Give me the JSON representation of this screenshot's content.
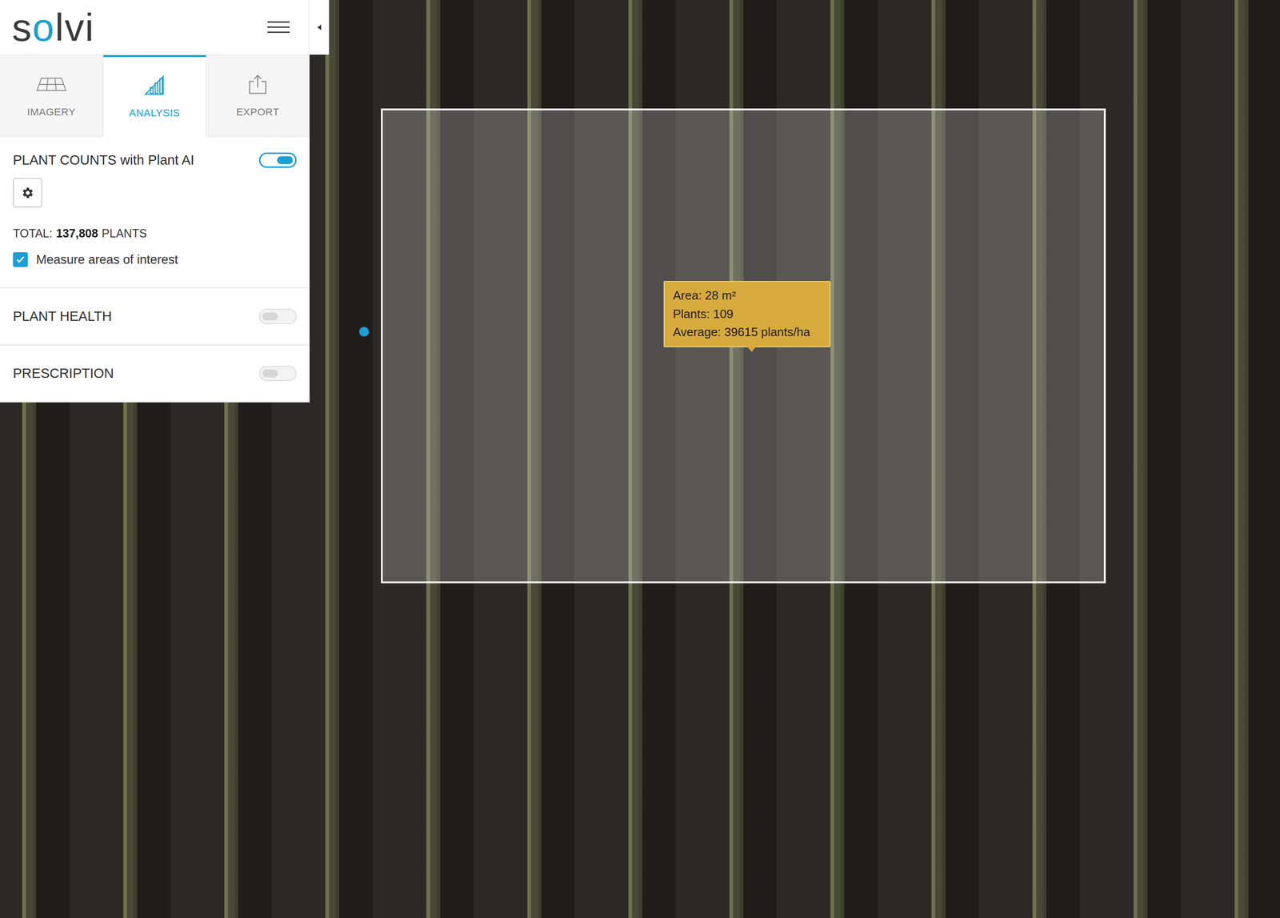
{
  "app": {
    "logo": [
      {
        "text": "s",
        "color": "#3a3a3a"
      },
      {
        "text": "o",
        "color": "#1a9fd6"
      },
      {
        "text": "lvi",
        "color": "#3a3a3a"
      }
    ]
  },
  "tabs": [
    {
      "label": "IMAGERY",
      "selected": false
    },
    {
      "label": "ANALYSIS",
      "selected": true
    },
    {
      "label": "EXPORT",
      "selected": false
    }
  ],
  "plant_counts": {
    "title": "PLANT COUNTS with Plant AI",
    "on": true,
    "total_label": "TOTAL:",
    "total_value": "137,808",
    "total_unit": "PLANTS",
    "checkbox": {
      "label": "Measure areas of interest",
      "checked": true
    }
  },
  "sections": [
    {
      "title": "PLANT HEALTH",
      "on": false
    },
    {
      "title": "PRESCRIPTION",
      "on": false
    }
  ],
  "tooltip": {
    "lines": [
      "Area: 28 m²",
      "Plants: 109",
      "Average: 39615 plants/ha"
    ]
  }
}
